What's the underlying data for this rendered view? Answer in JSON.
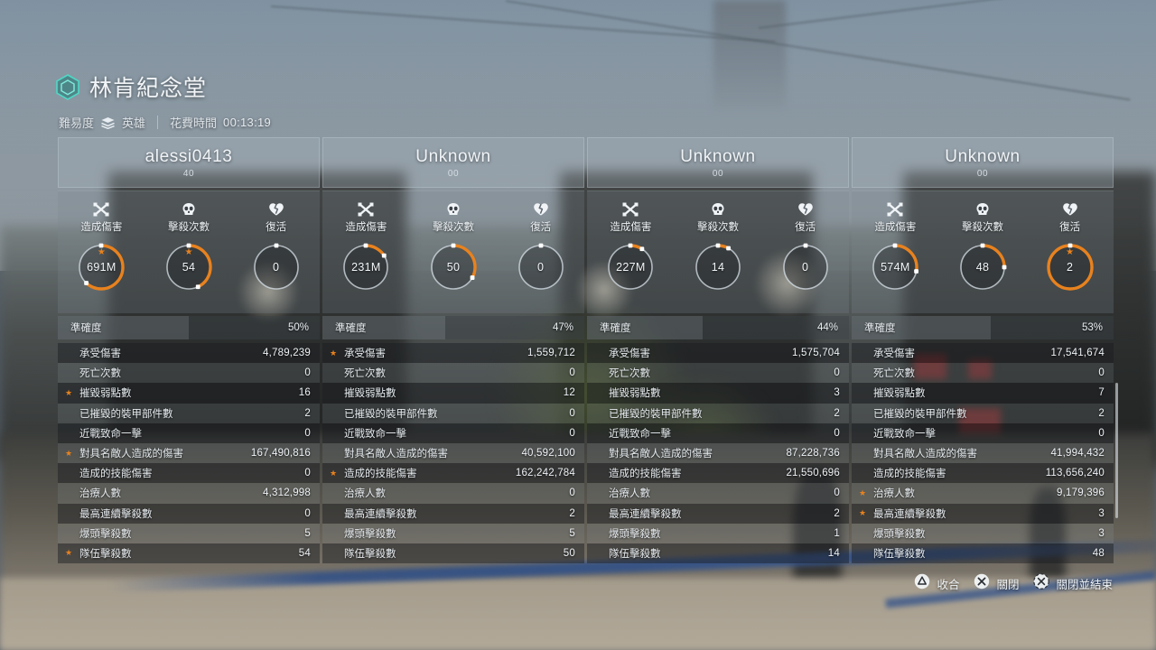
{
  "header": {
    "mission_icon": "hexagon-icon",
    "mission_title": "林肯紀念堂",
    "difficulty_label": "難易度",
    "difficulty_icon": "chevron-stack-icon",
    "difficulty_value": "英雄",
    "time_label": "花費時間",
    "time_value": "00:13:19"
  },
  "gauge_headers": [
    {
      "icon": "crossed-swords-icon",
      "label": "造成傷害"
    },
    {
      "icon": "skull-icon",
      "label": "擊殺次數"
    },
    {
      "icon": "mending-heart-icon",
      "label": "復活"
    }
  ],
  "accuracy_label": "準確度",
  "stat_labels": [
    "承受傷害",
    "死亡次數",
    "摧毀弱點數",
    "已摧毀的裝甲部件數",
    "近戰致命一擊",
    "對具名敵人造成的傷害",
    "造成的技能傷害",
    "治療人數",
    "最高連續擊殺數",
    "爆頭擊殺數",
    "隊伍擊殺數"
  ],
  "players": [
    {
      "name": "alessi0413",
      "level": "40",
      "gauges": [
        {
          "value": "691M",
          "pct": 62,
          "star": true,
          "full": false
        },
        {
          "value": "54",
          "pct": 43,
          "star": true,
          "full": false
        },
        {
          "value": "0",
          "pct": 0,
          "star": false,
          "full": false
        }
      ],
      "accuracy": "50%",
      "accuracy_pct": 50,
      "stats": [
        {
          "value": "4,789,239",
          "star": false
        },
        {
          "value": "0",
          "star": false
        },
        {
          "value": "16",
          "star": true
        },
        {
          "value": "2",
          "star": false
        },
        {
          "value": "0",
          "star": false
        },
        {
          "value": "167,490,816",
          "star": true
        },
        {
          "value": "0",
          "star": false
        },
        {
          "value": "4,312,998",
          "star": false
        },
        {
          "value": "0",
          "star": false
        },
        {
          "value": "5",
          "star": false
        },
        {
          "value": "54",
          "star": true
        }
      ]
    },
    {
      "name": "Unknown",
      "level": "00",
      "gauges": [
        {
          "value": "231M",
          "pct": 16,
          "star": false,
          "full": false
        },
        {
          "value": "50",
          "pct": 33,
          "star": false,
          "full": false
        },
        {
          "value": "0",
          "pct": 0,
          "star": false,
          "full": false
        }
      ],
      "accuracy": "47%",
      "accuracy_pct": 47,
      "stats": [
        {
          "value": "1,559,712",
          "star": true
        },
        {
          "value": "0",
          "star": false
        },
        {
          "value": "12",
          "star": false
        },
        {
          "value": "0",
          "star": false
        },
        {
          "value": "0",
          "star": false
        },
        {
          "value": "40,592,100",
          "star": false
        },
        {
          "value": "162,242,784",
          "star": true
        },
        {
          "value": "0",
          "star": false
        },
        {
          "value": "2",
          "star": false
        },
        {
          "value": "5",
          "star": false
        },
        {
          "value": "50",
          "star": false
        }
      ]
    },
    {
      "name": "Unknown",
      "level": "00",
      "gauges": [
        {
          "value": "227M",
          "pct": 9,
          "star": false,
          "full": false
        },
        {
          "value": "14",
          "pct": 8,
          "star": false,
          "full": false
        },
        {
          "value": "0",
          "pct": 0,
          "star": false,
          "full": false
        }
      ],
      "accuracy": "44%",
      "accuracy_pct": 44,
      "stats": [
        {
          "value": "1,575,704",
          "star": false
        },
        {
          "value": "0",
          "star": false
        },
        {
          "value": "3",
          "star": false
        },
        {
          "value": "2",
          "star": false
        },
        {
          "value": "0",
          "star": false
        },
        {
          "value": "87,228,736",
          "star": false
        },
        {
          "value": "21,550,696",
          "star": false
        },
        {
          "value": "0",
          "star": false
        },
        {
          "value": "2",
          "star": false
        },
        {
          "value": "1",
          "star": false
        },
        {
          "value": "14",
          "star": false
        }
      ]
    },
    {
      "name": "Unknown",
      "level": "00",
      "gauges": [
        {
          "value": "574M",
          "pct": 28,
          "star": false,
          "full": false
        },
        {
          "value": "48",
          "pct": 25,
          "star": false,
          "full": false
        },
        {
          "value": "2",
          "pct": 100,
          "star": true,
          "full": true
        }
      ],
      "accuracy": "53%",
      "accuracy_pct": 53,
      "stats": [
        {
          "value": "17,541,674",
          "star": false
        },
        {
          "value": "0",
          "star": false
        },
        {
          "value": "7",
          "star": false
        },
        {
          "value": "2",
          "star": false
        },
        {
          "value": "0",
          "star": false
        },
        {
          "value": "41,994,432",
          "star": false
        },
        {
          "value": "113,656,240",
          "star": false
        },
        {
          "value": "9,179,396",
          "star": true
        },
        {
          "value": "3",
          "star": true
        },
        {
          "value": "3",
          "star": false
        },
        {
          "value": "48",
          "star": false
        }
      ]
    }
  ],
  "footer_buttons": [
    {
      "icon": "playstation-triangle-icon",
      "label": "收合"
    },
    {
      "icon": "playstation-cross-icon",
      "label": "關閉"
    },
    {
      "icon": "playstation-cross-hold-icon",
      "label": "關閉並結束"
    }
  ],
  "colors": {
    "accent_orange": "#e8821e",
    "hex_teal": "#3fd0c0",
    "text_primary": "#eef2f6"
  }
}
